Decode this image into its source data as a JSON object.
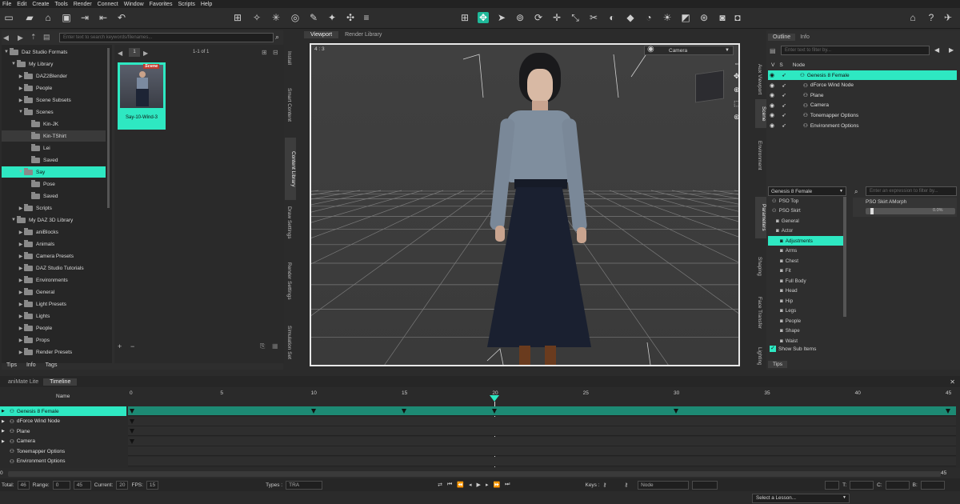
{
  "menu": [
    "File",
    "Edit",
    "Create",
    "Tools",
    "Render",
    "Connect",
    "Window",
    "Favorites",
    "Scripts",
    "Help"
  ],
  "content": {
    "search_placeholder": "Enter text to search keywords/filenames...",
    "page_number": "1",
    "page_range": "1-1 of 1",
    "tree": [
      {
        "label": "Daz Studio Formats",
        "depth": 0,
        "expanded": true
      },
      {
        "label": "My Library",
        "depth": 1,
        "expanded": true
      },
      {
        "label": "DAZ2Blender",
        "depth": 2
      },
      {
        "label": "People",
        "depth": 2
      },
      {
        "label": "Scene Subsets",
        "depth": 2
      },
      {
        "label": "Scenes",
        "depth": 2,
        "expanded": true
      },
      {
        "label": "Kin-JK",
        "depth": 3
      },
      {
        "label": "Kin-TShirt",
        "depth": 3,
        "hl": true
      },
      {
        "label": "Lei",
        "depth": 3
      },
      {
        "label": "Saved",
        "depth": 3
      },
      {
        "label": "Say",
        "depth": 2,
        "expanded": true,
        "selected": true
      },
      {
        "label": "Pose",
        "depth": 3
      },
      {
        "label": "Saved",
        "depth": 3
      },
      {
        "label": "Scripts",
        "depth": 2
      },
      {
        "label": "My DAZ 3D Library",
        "depth": 1,
        "expanded": true
      },
      {
        "label": "aniBlocks",
        "depth": 2
      },
      {
        "label": "Animals",
        "depth": 2
      },
      {
        "label": "Camera Presets",
        "depth": 2
      },
      {
        "label": "DAZ Studio Tutorials",
        "depth": 2
      },
      {
        "label": "Environments",
        "depth": 2
      },
      {
        "label": "General",
        "depth": 2
      },
      {
        "label": "Light Presets",
        "depth": 2
      },
      {
        "label": "Lights",
        "depth": 2
      },
      {
        "label": "People",
        "depth": 2
      },
      {
        "label": "Props",
        "depth": 2
      },
      {
        "label": "Render Presets",
        "depth": 2
      }
    ],
    "thumb_badge": "Scene",
    "thumb_label": "Say-10-Wind-3",
    "tabs": [
      "Tips",
      "Info",
      "Tags"
    ]
  },
  "side_tabs": [
    "Install",
    "Smart Content",
    "Content Library",
    "Draw Settings",
    "Render Settings",
    "Simulation Set"
  ],
  "viewport": {
    "tabs": [
      "Viewport",
      "Render Library"
    ],
    "aspect": "4 : 3",
    "camera": "Camera"
  },
  "outline": {
    "tabs": [
      "Outline",
      "Info"
    ],
    "filter_placeholder": "Enter text to filter by...",
    "cols": [
      "V",
      "S",
      "Node"
    ],
    "rows": [
      {
        "label": "Genesis 8 Female",
        "selected": true
      },
      {
        "label": "dForce Wind Node"
      },
      {
        "label": "Plane"
      },
      {
        "label": "Camera"
      },
      {
        "label": "Tonemapper Options"
      },
      {
        "label": "Environment Options"
      }
    ]
  },
  "right_vtabs": [
    "Aux Viewport",
    "Scene",
    "Environment",
    "Parameters",
    "Shaping",
    "Face Transfer",
    "Lighting"
  ],
  "params": {
    "node": "Genesis 8 Female",
    "filter_placeholder": "Enter an expression to filter by...",
    "rows": [
      {
        "label": "PSO Top"
      },
      {
        "label": "PSO Skirt"
      },
      {
        "label": "General"
      },
      {
        "label": "Actor"
      },
      {
        "label": "Adjustments",
        "selected": true
      },
      {
        "label": "Arms"
      },
      {
        "label": "Chest"
      },
      {
        "label": "Fit"
      },
      {
        "label": "Full Body"
      },
      {
        "label": "Head"
      },
      {
        "label": "Hip"
      },
      {
        "label": "Legs"
      },
      {
        "label": "People"
      },
      {
        "label": "Shape"
      },
      {
        "label": "Waist"
      }
    ],
    "show_sub": "Show Sub Items",
    "morph_name": "PSO Skirt AMorph",
    "morph_value": "0.0%",
    "tips_tab": "Tips"
  },
  "timeline": {
    "tabs": [
      "aniMate Lite",
      "Timeline"
    ],
    "name_header": "Name",
    "ticks": [
      "0",
      "5",
      "10",
      "15",
      "20",
      "25",
      "30",
      "35",
      "40",
      "45"
    ],
    "current_frame": 20,
    "rows": [
      {
        "label": "Genesis 8 Female",
        "selected": true
      },
      {
        "label": "dForce Wind Node"
      },
      {
        "label": "Plane"
      },
      {
        "label": "Camera"
      },
      {
        "label": "Tonemapper Options"
      },
      {
        "label": "Environment Options"
      }
    ],
    "keys_genesis": [
      0,
      10,
      15,
      20,
      30,
      45
    ],
    "keys_wind": [
      0
    ],
    "keys_plane": [
      0
    ],
    "keys_camera": [
      0
    ],
    "range_start": "0",
    "range_end": "45"
  },
  "statusbar": {
    "total_label": "Total:",
    "total": "46",
    "range_label": "Range:",
    "range_start": "0",
    "range_end": "45",
    "current_label": "Current:",
    "current": "20",
    "fps_label": "FPS:",
    "fps": "15",
    "types_label": "Types :",
    "types": "TRA",
    "keys_label": "Keys :",
    "keys_mode": "Node",
    "t_label": "T:",
    "c_label": "C:",
    "b_label": "B:"
  },
  "lesson": "Select a Lesson...",
  "colors": {
    "accent": "#2ee8c2",
    "bg": "#2b2b2b",
    "panel": "#333333"
  }
}
